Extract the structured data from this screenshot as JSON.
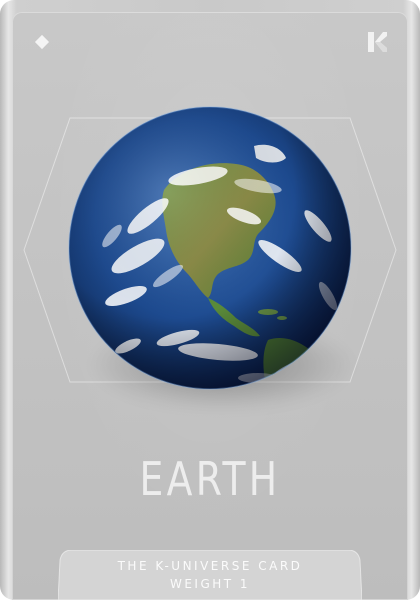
{
  "card": {
    "title": "EARTH",
    "subtitle": "THE K-UNIVERSE CARD",
    "weight_label": "WEIGHT 1"
  },
  "icons": {
    "top_left": "diamond-icon",
    "top_right": "k-logo-icon"
  },
  "colors": {
    "card_silver": "#c6c6c6",
    "title_text": "#ededed",
    "ocean_blue": "#1d4a8f",
    "land_green": "#5f8a3c"
  }
}
